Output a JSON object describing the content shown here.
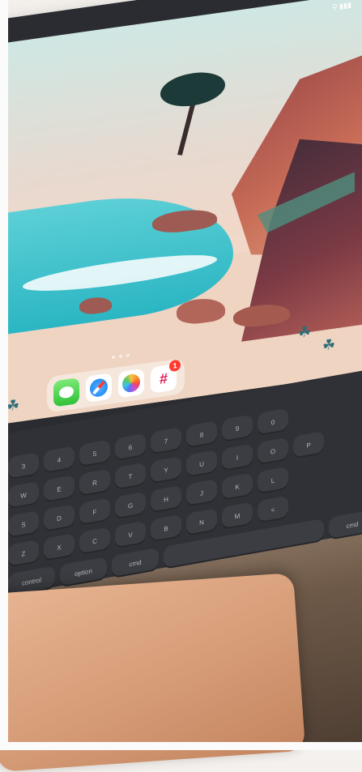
{
  "scene": {
    "device": "tablet-with-keyboard-case",
    "wallpaper": "stylized-coastal-cliffs"
  },
  "dock": {
    "apps": [
      {
        "name": "messages",
        "icon": "messages-icon"
      },
      {
        "name": "safari",
        "icon": "safari-icon"
      },
      {
        "name": "photos",
        "icon": "photos-icon"
      },
      {
        "name": "slack",
        "icon": "slack-icon",
        "badge": "1"
      }
    ]
  },
  "keyboard": {
    "rows": [
      [
        "3",
        "4",
        "5",
        "6",
        "7",
        "8",
        "9",
        "0"
      ],
      [
        "W",
        "E",
        "R",
        "T",
        "Y",
        "U",
        "I",
        "O",
        "P"
      ],
      [
        "S",
        "D",
        "F",
        "G",
        "H",
        "J",
        "K",
        "L"
      ],
      [
        "Z",
        "X",
        "C",
        "V",
        "B",
        "N",
        "M",
        "<"
      ],
      [
        "control",
        "option",
        "cmd",
        "",
        "cmd"
      ]
    ]
  },
  "colors": {
    "sea": "#2bb6c3",
    "sand": "#efd4c2",
    "cliff": "#8d3e44",
    "keyboard": "#2f3136",
    "laptop": "#d69c78",
    "badge": "#ff3b30"
  }
}
